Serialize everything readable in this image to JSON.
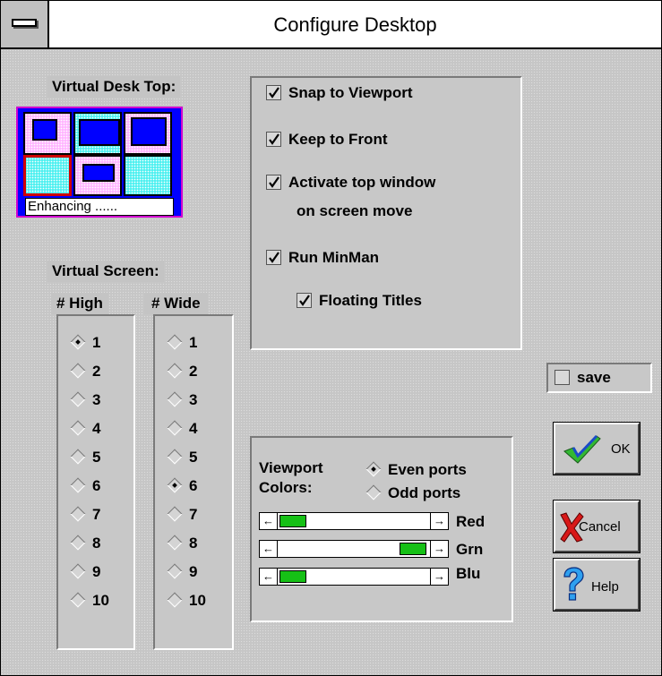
{
  "window": {
    "title": "Configure Desktop"
  },
  "virtual_desktop": {
    "label": "Virtual Desk Top:",
    "status_text": "Enhancing ......"
  },
  "virtual_screen": {
    "label": "Virtual Screen:",
    "high_header": "# High",
    "wide_header": "# Wide",
    "high_options": [
      "1",
      "2",
      "3",
      "4",
      "5",
      "6",
      "7",
      "8",
      "9",
      "10"
    ],
    "wide_options": [
      "1",
      "2",
      "3",
      "4",
      "5",
      "6",
      "7",
      "8",
      "9",
      "10"
    ],
    "high_selected": "1",
    "wide_selected": "6"
  },
  "options": {
    "snap": "Snap to Viewport",
    "keep_front": "Keep to Front",
    "activate_line1": "Activate top window",
    "activate_line2": "on screen move",
    "run_minman": "Run MinMan",
    "floating_titles": "Floating Titles",
    "checked": [
      true,
      true,
      true,
      true,
      true
    ]
  },
  "save": {
    "label": "save",
    "checked": false
  },
  "viewport_colors": {
    "label_line1": "Viewport",
    "label_line2": "Colors:",
    "even_ports": "Even ports",
    "odd_ports": "Odd ports",
    "selected": "Even ports",
    "red_label": "Red",
    "green_label": "Grn",
    "blue_label": "Blu",
    "red_level": 0.0,
    "green_level": 1.0,
    "blue_level": 0.0,
    "thumb_color": "#16c016"
  },
  "buttons": {
    "ok": "OK",
    "cancel": "Cancel",
    "help": "Help"
  },
  "icons": {
    "system_menu": "system-menu-icon",
    "ok": "checkmark-icon",
    "cancel": "red-x-icon",
    "help": "question-mark-icon"
  }
}
